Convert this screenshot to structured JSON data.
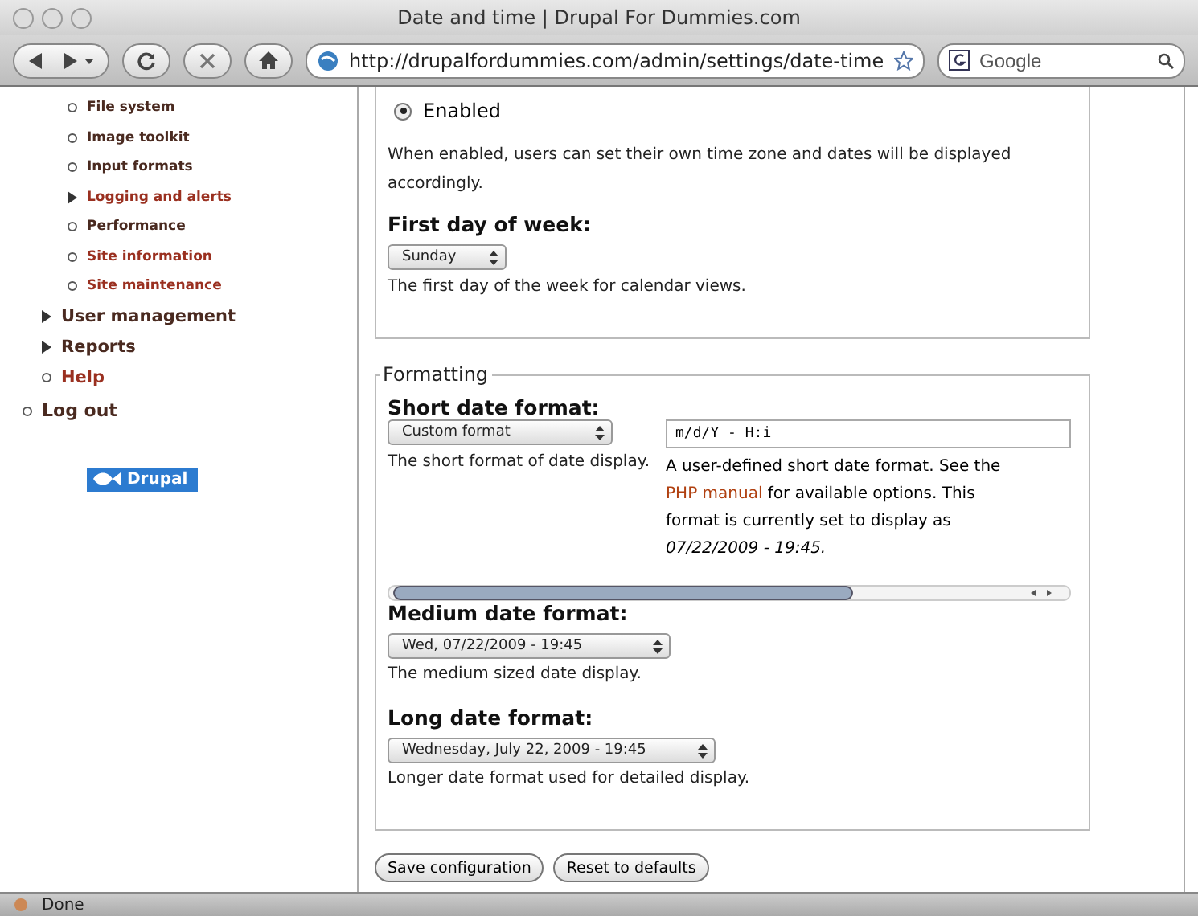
{
  "window": {
    "title": "Date and time | Drupal For Dummies.com"
  },
  "toolbar": {
    "url": "http://drupalfordummies.com/admin/settings/date-time",
    "search_placeholder": "Google"
  },
  "sidebar": {
    "items": [
      {
        "children": [
          {
            "children": [
              {
                "label": "File system",
                "kind": "leaf",
                "visited": false
              },
              {
                "label": "Image toolkit",
                "kind": "leaf",
                "visited": false
              },
              {
                "label": "Input formats",
                "kind": "leaf",
                "visited": false
              },
              {
                "label": "Logging and alerts",
                "kind": "collapsed",
                "visited": true
              },
              {
                "label": "Performance",
                "kind": "leaf",
                "visited": false
              },
              {
                "label": "Site information",
                "kind": "leaf",
                "visited": true
              },
              {
                "label": "Site maintenance",
                "kind": "leaf",
                "visited": true
              }
            ]
          },
          {
            "label": "User management",
            "kind": "collapsed",
            "visited": false
          },
          {
            "label": "Reports",
            "kind": "collapsed",
            "visited": false
          },
          {
            "label": "Help",
            "kind": "leaf",
            "visited": true
          }
        ]
      },
      {
        "label": "Log out",
        "kind": "leaf",
        "visited": false
      }
    ],
    "badge": "Drupal"
  },
  "user_timezones": {
    "option": {
      "label": "Enabled",
      "selected": true
    },
    "description": "When enabled, users can set their own time zone and dates will be displayed accordingly.",
    "first_day": {
      "label": "First day of week:",
      "value": "Sunday",
      "description": "The first day of the week for calendar views."
    }
  },
  "formatting": {
    "legend": "Formatting",
    "short": {
      "label": "Short date format:",
      "value": "Custom format",
      "description": "The short format of date display.",
      "custom_value": "m/d/Y - H:i",
      "help_before": "A user-defined short date format. See the ",
      "help_link": "PHP manual",
      "help_after": " for available options. This format is currently set to display as ",
      "help_example": "07/22/2009 - 19:45."
    },
    "medium": {
      "label": "Medium date format:",
      "value": "Wed, 07/22/2009 - 19:45",
      "description": "The medium sized date display."
    },
    "long": {
      "label": "Long date format:",
      "value": "Wednesday, July 22, 2009 - 19:45",
      "description": "Longer date format used for detailed display."
    }
  },
  "buttons": [
    "Save configuration",
    "Reset to defaults"
  ],
  "status_bar": "Done"
}
